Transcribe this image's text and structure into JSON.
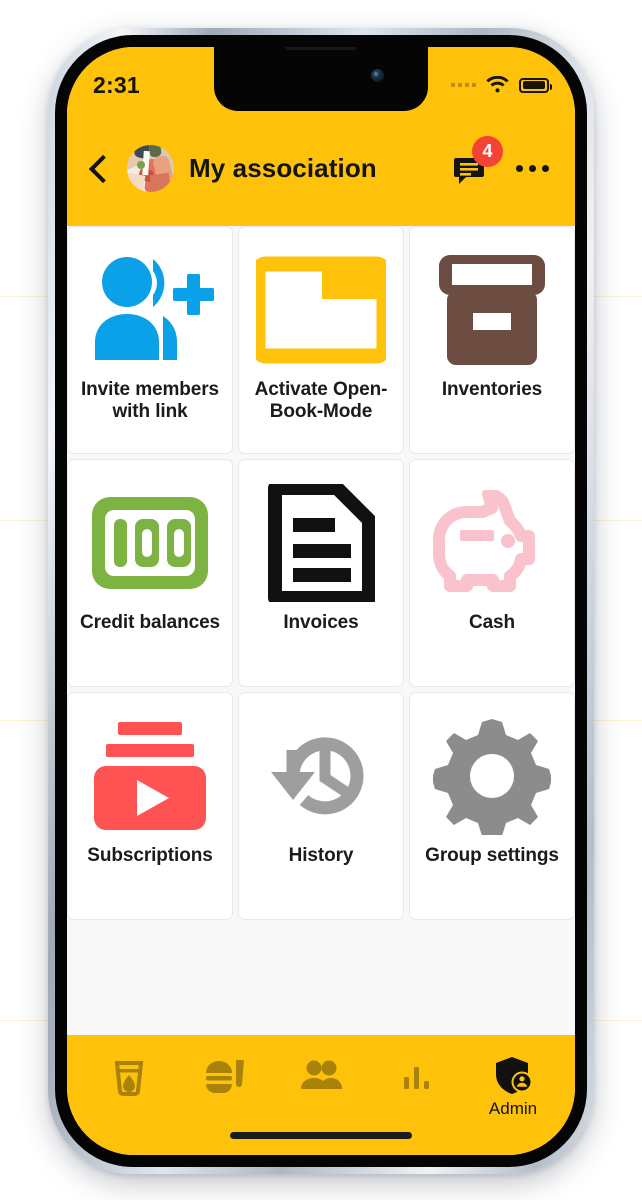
{
  "statusbar": {
    "time": "2:31",
    "wifi_icon": "wifi-icon",
    "battery_icon": "battery-full-icon",
    "signal_icon": "signal-dots-icon"
  },
  "header": {
    "back_icon": "back-chevron-icon",
    "avatar": "group-avatar",
    "title": "My association",
    "chat_icon": "chat-bubble-icon",
    "badge_count": "4",
    "overflow_icon": "more-options-icon"
  },
  "colors": {
    "brand_yellow": "#FFC20A",
    "badge_red": "#F44336",
    "invite_blue": "#0BA1E8",
    "folder_amber": "#FFC20A",
    "inventory_brown": "#6D4C41",
    "credit_green": "#7CB342",
    "invoice_black": "#111111",
    "cash_pink": "#FAC2CC",
    "subscription_red": "#FF5252",
    "history_gray": "#9E9E9E",
    "settings_gray": "#8C8C8C",
    "page_bg": "#F8F8F8"
  },
  "grid": {
    "tiles": [
      {
        "id": "invite-members",
        "label": "Invite members with link",
        "icon": "add-person-icon"
      },
      {
        "id": "open-book-mode",
        "label": "Activate Open-Book-Mode",
        "icon": "open-folder-icon"
      },
      {
        "id": "inventories",
        "label": "Inventories",
        "icon": "archive-box-icon"
      },
      {
        "id": "credit-balances",
        "label": "Credit balances",
        "icon": "hundred-credits-icon"
      },
      {
        "id": "invoices",
        "label": "Invoices",
        "icon": "document-icon"
      },
      {
        "id": "cash",
        "label": "Cash",
        "icon": "piggy-bank-icon"
      },
      {
        "id": "subscriptions",
        "label": "Subscriptions",
        "icon": "subscription-play-icon"
      },
      {
        "id": "history",
        "label": "History",
        "icon": "history-clock-icon"
      },
      {
        "id": "group-settings",
        "label": "Group settings",
        "icon": "gear-icon"
      }
    ]
  },
  "bottomnav": {
    "items": [
      {
        "id": "drinks",
        "label": "",
        "icon": "drink-glass-icon",
        "active": false
      },
      {
        "id": "food",
        "label": "",
        "icon": "food-burger-icon",
        "active": false
      },
      {
        "id": "members",
        "label": "",
        "icon": "people-icon",
        "active": false
      },
      {
        "id": "stats",
        "label": "",
        "icon": "bar-chart-icon",
        "active": false
      },
      {
        "id": "admin",
        "label": "Admin",
        "icon": "shield-admin-icon",
        "active": true
      }
    ]
  }
}
